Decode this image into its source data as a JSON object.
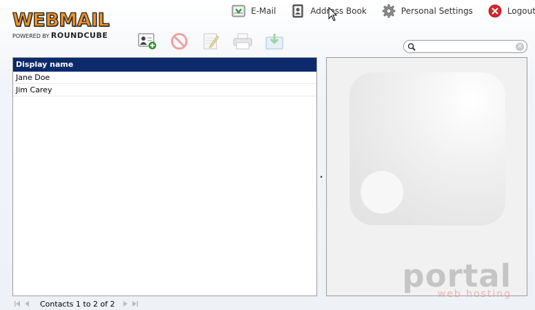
{
  "logo": {
    "title": "WEBMAIL",
    "powered_by": "POWERED BY",
    "brand": "ROUNDCUBE"
  },
  "nav": {
    "email": "E-Mail",
    "address_book": "Address Book",
    "settings": "Personal Settings",
    "logout": "Logout"
  },
  "toolbar": {
    "icons": [
      "add-contact-icon",
      "delete-icon",
      "edit-icon",
      "print-icon",
      "export-icon"
    ]
  },
  "search": {
    "value": "",
    "placeholder": ""
  },
  "contacts": {
    "header": "Display name",
    "rows": [
      "Jane Doe",
      "Jim Carey"
    ]
  },
  "footer": {
    "count_text": "Contacts 1 to 2 of 2"
  },
  "watermark": {
    "main": "portal",
    "sub": "web hosting"
  },
  "colors": {
    "header_bg": "#0d2a6b",
    "logo_orange": "#f7941d",
    "logout_red": "#d9242b"
  }
}
